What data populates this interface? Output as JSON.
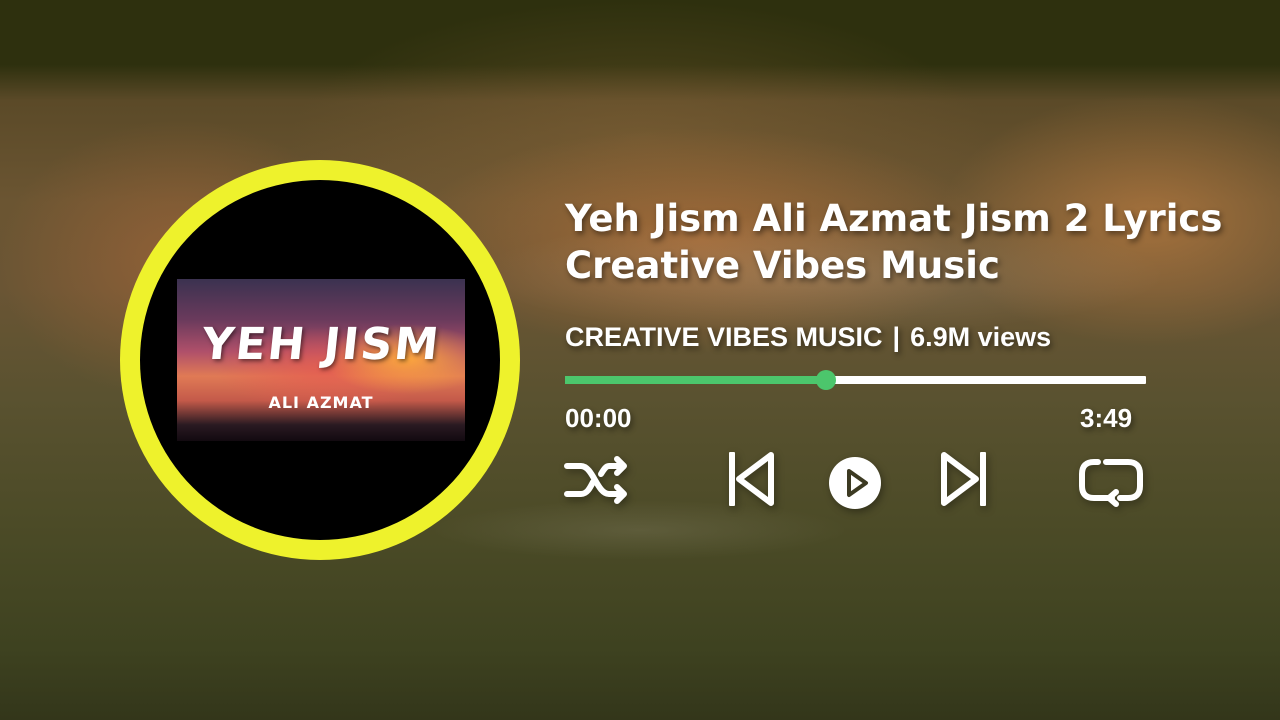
{
  "album_art": {
    "title_text": "YEH JISM",
    "subtitle_text": "ALI AZMAT"
  },
  "track": {
    "title": "Yeh Jism Ali Azmat Jism 2 Lyrics Creative Vibes Music",
    "channel": "CREATIVE VIBES MUSIC",
    "separator": "|",
    "views": "6.9M views"
  },
  "playback": {
    "elapsed": "00:00",
    "duration": "3:49",
    "progress_fraction": 0.45
  },
  "controls": {
    "shuffle_icon": "shuffle-icon",
    "previous_icon": "skip-previous-icon",
    "play_icon": "play-icon",
    "next_icon": "skip-next-icon",
    "repeat_icon": "repeat-icon"
  },
  "colors": {
    "ring": "#eef22c",
    "progress_accent": "#4cc66c",
    "progress_track": "#ffffff",
    "text": "#ffffff"
  }
}
